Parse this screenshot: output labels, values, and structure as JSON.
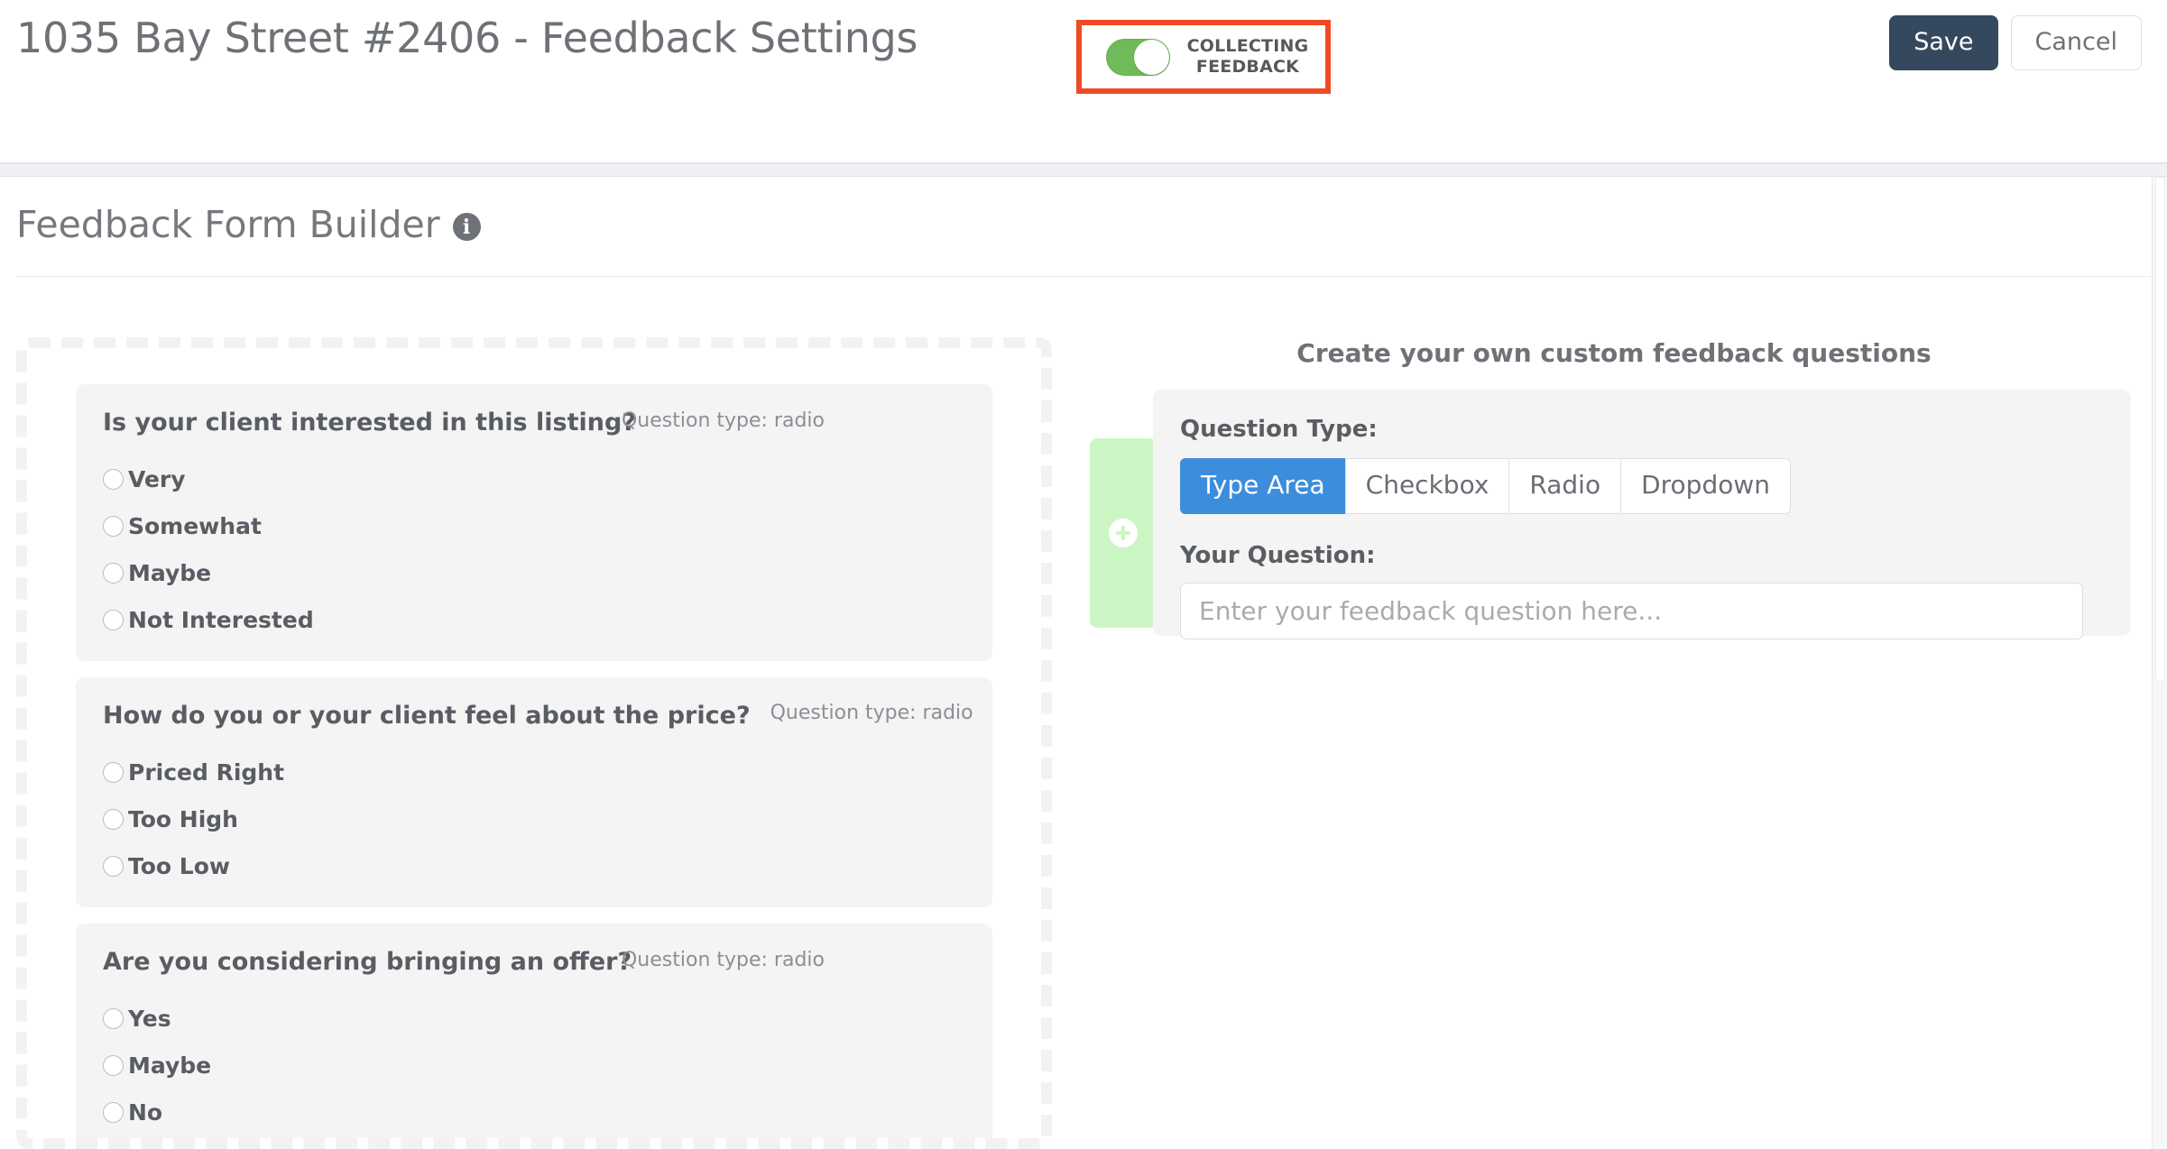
{
  "header": {
    "title": "1035 Bay Street #2406 - Feedback Settings",
    "toggle": {
      "label": "COLLECTING FEEDBACK",
      "state": "on",
      "on_color": "#6fba59",
      "highlight_color": "#f04a25"
    },
    "save_label": "Save",
    "cancel_label": "Cancel",
    "save_color": "#34495e"
  },
  "builder": {
    "title": "Feedback Form Builder",
    "info_icon": "info-icon",
    "info_glyph": "i"
  },
  "questions": [
    {
      "title": "Is your client interested in this listing?",
      "type_label": "Question type: radio",
      "options": [
        "Very",
        "Somewhat",
        "Maybe",
        "Not Interested"
      ]
    },
    {
      "title": "How do you or your client feel about the price?",
      "type_label": "Question type: radio",
      "options": [
        "Priced Right",
        "Too High",
        "Too Low"
      ]
    },
    {
      "title": "Are you considering bringing an offer?",
      "type_label": "Question type: radio",
      "options": [
        "Yes",
        "Maybe",
        "No"
      ]
    }
  ],
  "custom": {
    "heading": "Create your own custom feedback questions",
    "add_icon": "plus-circle-icon",
    "add_strip_color": "#ccf5c4",
    "question_type_label": "Question Type:",
    "types": [
      "Type Area",
      "Checkbox",
      "Radio",
      "Dropdown"
    ],
    "selected_type": "Type Area",
    "selected_color": "#3c8ddc",
    "your_question_label": "Your Question:",
    "question_value": "",
    "question_placeholder": "Enter your feedback question here..."
  }
}
